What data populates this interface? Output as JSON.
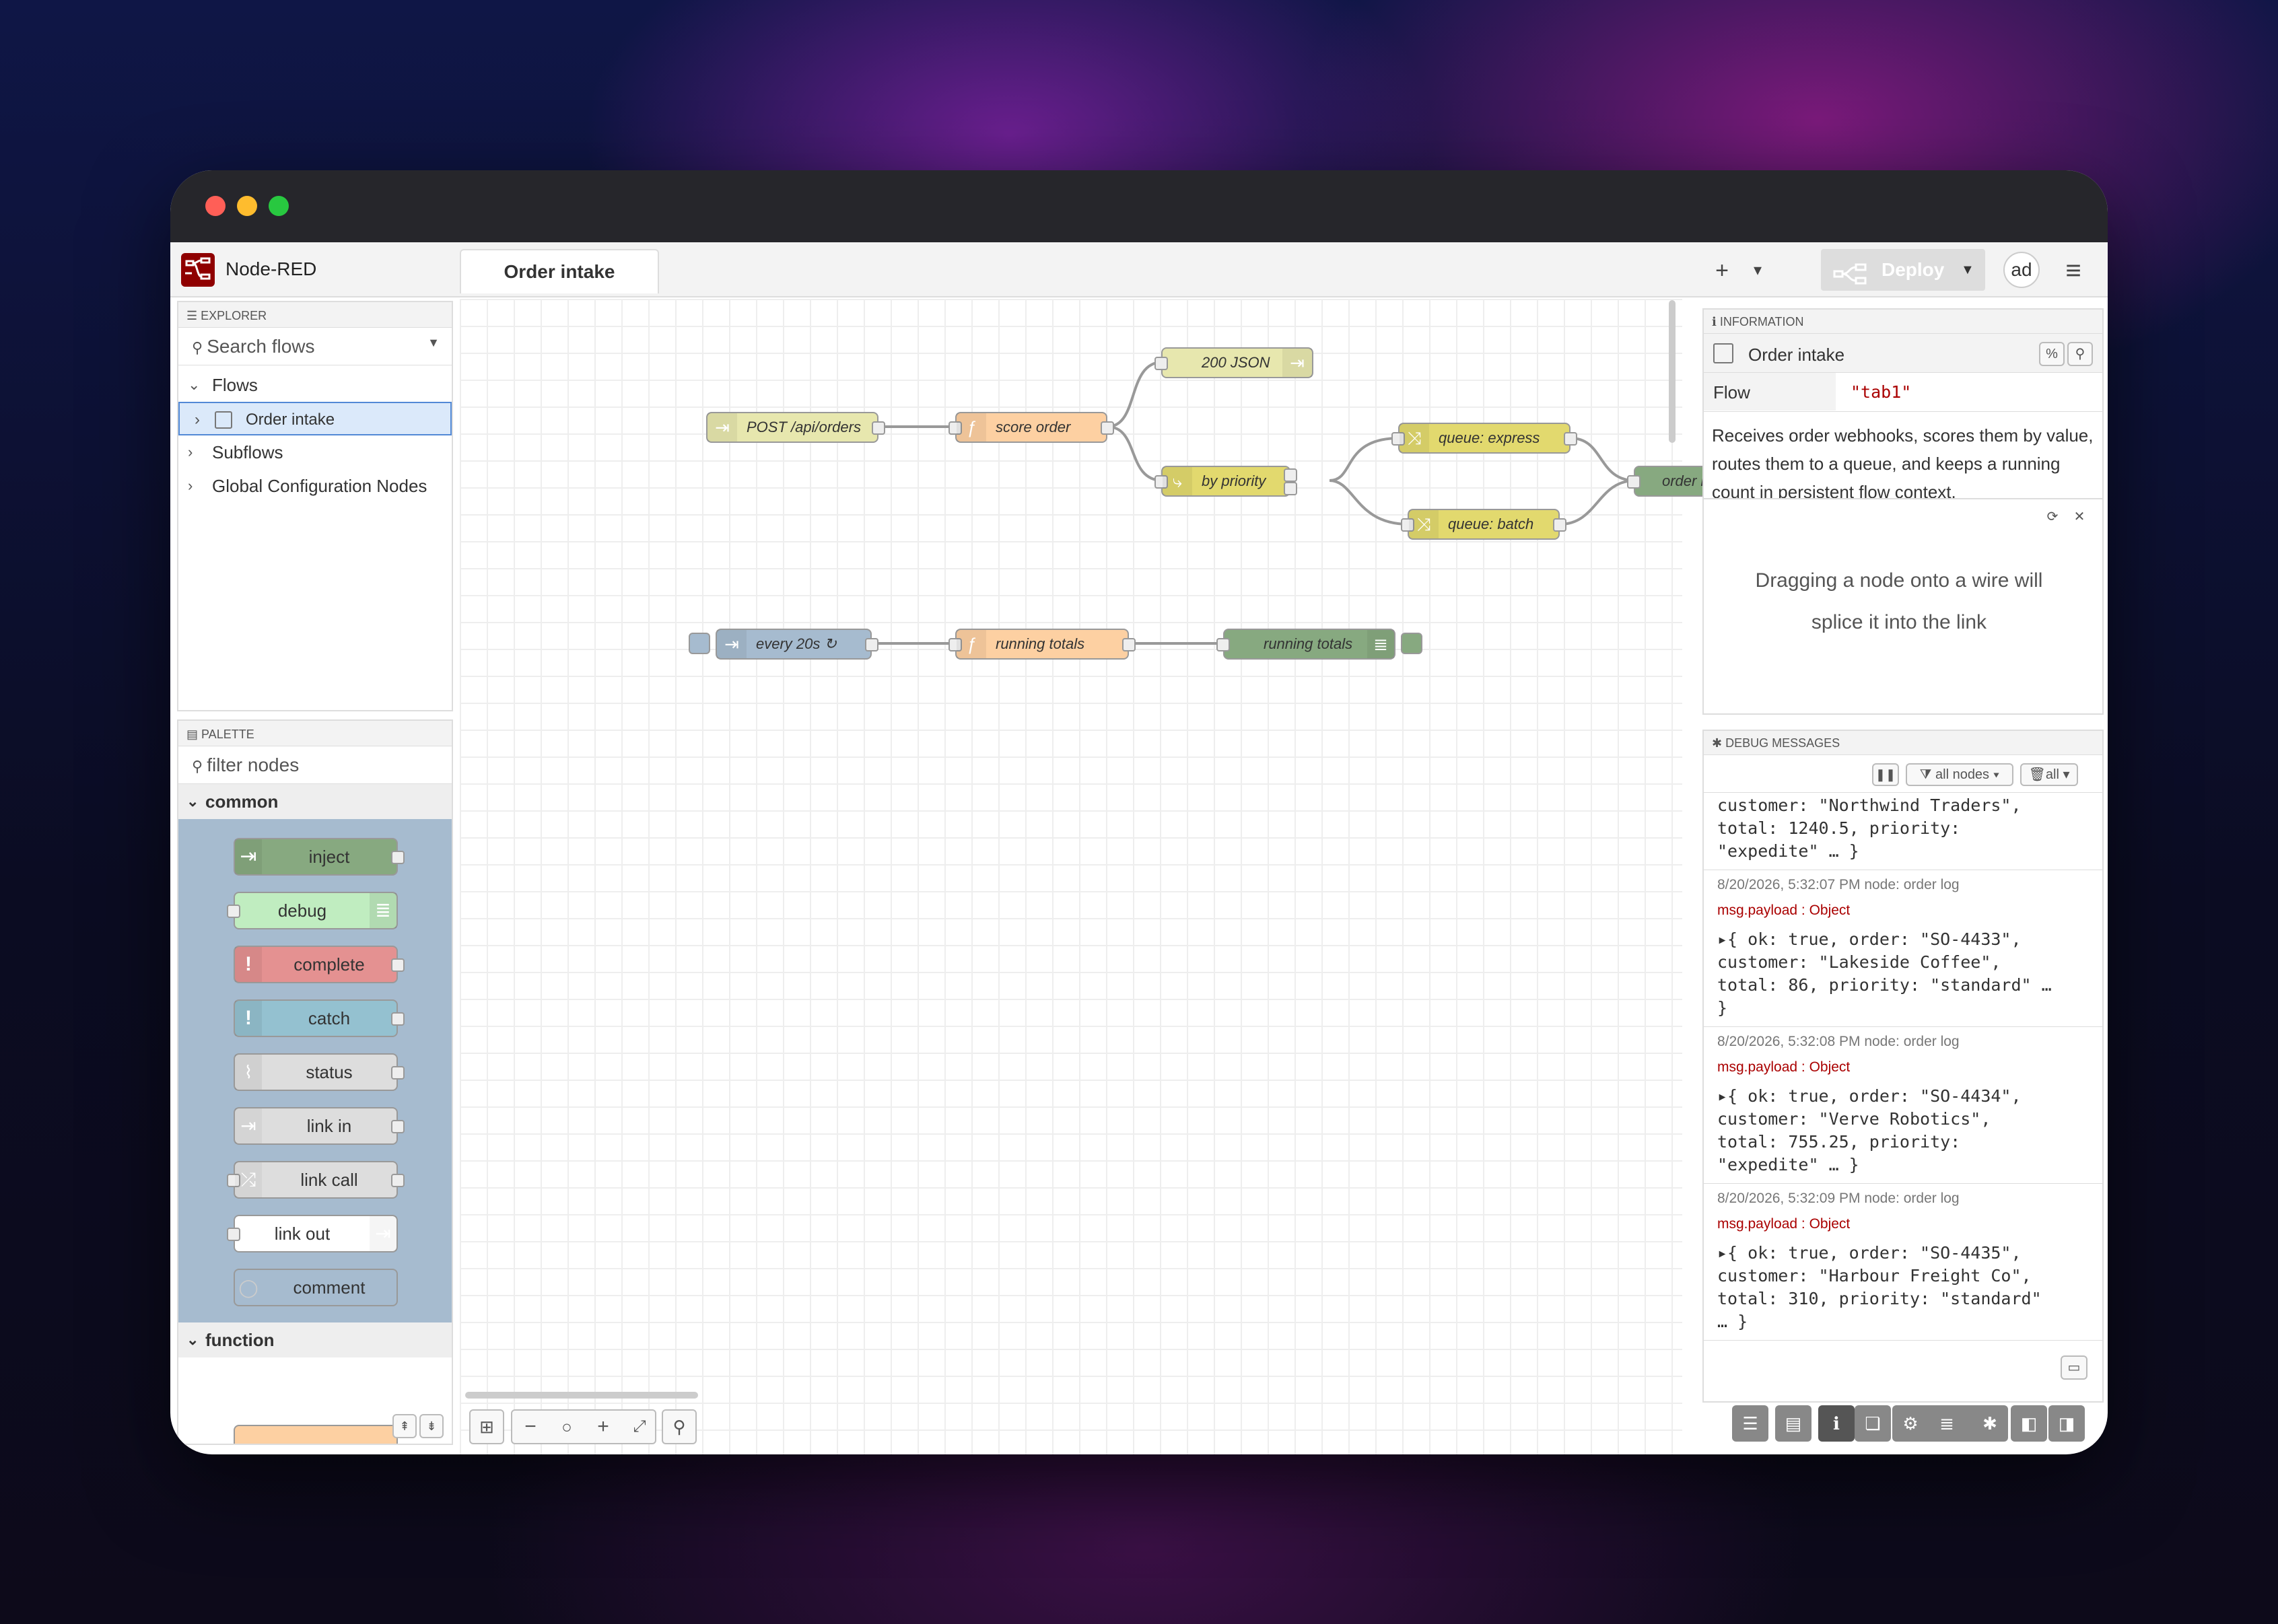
{
  "app": {
    "title": "Node-RED"
  },
  "header": {
    "tab": "Order intake",
    "add_flow": "+",
    "tab_menu": "▾",
    "deploy_label": "Deploy",
    "user_avatar": "ad",
    "menu_icon": "≡"
  },
  "explorer": {
    "section_title": "EXPLORER",
    "search_placeholder": "Search flows",
    "items": [
      {
        "label": "Flows"
      },
      {
        "label": "Order intake"
      },
      {
        "label": "Subflows"
      },
      {
        "label": "Global Configuration Nodes"
      }
    ]
  },
  "palette": {
    "section_title": "PALETTE",
    "filter_placeholder": "filter nodes",
    "category_common": "common",
    "category_function": "function",
    "nodes": [
      {
        "label": "inject",
        "color": "#a6bbcf"
      },
      {
        "label": "debug",
        "color": "#87a980"
      },
      {
        "label": "complete",
        "color": "#c0edc0"
      },
      {
        "label": "catch",
        "color": "#e49191"
      },
      {
        "label": "status",
        "color": "#94c1d0"
      },
      {
        "label": "link in",
        "color": "#dddddd"
      },
      {
        "label": "link call",
        "color": "#dddddd"
      },
      {
        "label": "link out",
        "color": "#dddddd"
      },
      {
        "label": "comment",
        "color": "#ffffff"
      }
    ]
  },
  "flow": {
    "nodes": [
      {
        "label": "POST /api/orders",
        "color": "#e7e7ae"
      },
      {
        "label": "score order",
        "color": "#fdd0a2"
      },
      {
        "label": "200 JSON",
        "color": "#e7e7ae"
      },
      {
        "label": "by priority",
        "color": "#e2d96e"
      },
      {
        "label": "queue: express",
        "color": "#e2d96e"
      },
      {
        "label": "queue: batch",
        "color": "#e2d96e"
      },
      {
        "label": "order log",
        "color": "#87a980"
      },
      {
        "label": "every 20s ↻",
        "color": "#a6bbcf"
      },
      {
        "label": "running totals",
        "color": "#fdd0a2"
      },
      {
        "label": "running totals",
        "color": "#87a980"
      }
    ]
  },
  "info": {
    "section_title": "INFORMATION",
    "flow_name": "Order intake",
    "flow_key": "Flow",
    "flow_value": "\"tab1\"",
    "description": "Receives order webhooks, scores them by value, routes them to a queue, and keeps a running count in persistent flow context.",
    "tip": "Dragging a node onto a wire will splice it into the link"
  },
  "debug": {
    "section_title": "DEBUG MESSAGES",
    "filter_nodes": "all nodes",
    "clear_label": "all",
    "partial_top": [
      "customer: \"Northwind Traders\",",
      "total: 1240.5, priority:",
      "\"expedite\" … }"
    ],
    "messages": [
      {
        "meta": "8/20/2026, 5:32:07 PM   node: order log",
        "sub": "msg.payload : Object",
        "body": [
          "▸{ ok: true, order: \"SO-4433\",",
          "customer: \"Lakeside Coffee\",",
          "total: 86, priority: \"standard\" …",
          "}"
        ]
      },
      {
        "meta": "8/20/2026, 5:32:08 PM   node: order log",
        "sub": "msg.payload : Object",
        "body": [
          "▸{ ok: true, order: \"SO-4434\",",
          "customer: \"Verve Robotics\",",
          "total: 755.25, priority:",
          "\"expedite\" … }"
        ]
      },
      {
        "meta": "8/20/2026, 5:32:09 PM   node: order log",
        "sub": "msg.payload : Object",
        "body": [
          "▸{ ok: true, order: \"SO-4435\",",
          "customer: \"Harbour Freight Co\",",
          "total: 310, priority: \"standard\"",
          "… }"
        ]
      }
    ]
  }
}
